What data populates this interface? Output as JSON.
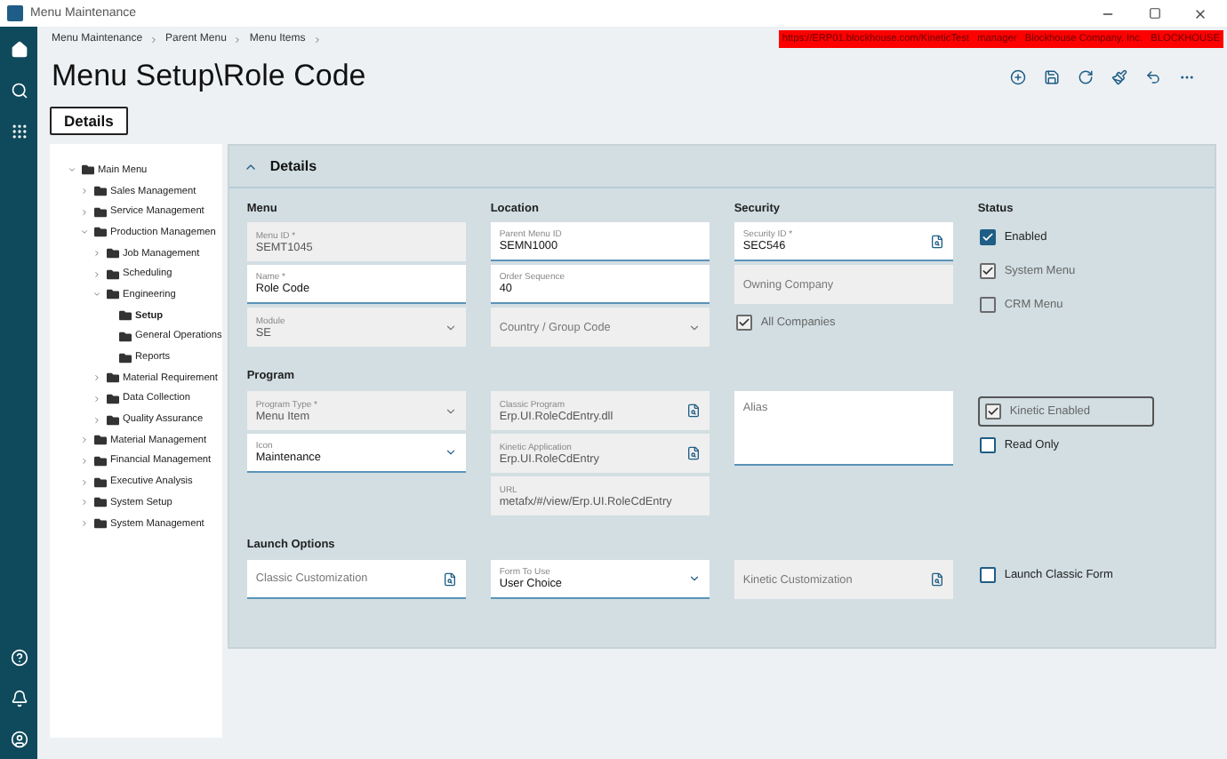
{
  "window": {
    "title": "Menu Maintenance"
  },
  "breadcrumbs": [
    "Menu Maintenance",
    "Parent Menu",
    "Menu Items"
  ],
  "connection_banner": "https://ERP01.blockhouse.com/KineticTest   manager   Blockhouse Company, Inc.   BLOCKHOUSE",
  "page_title": "Menu Setup\\Role Code",
  "tabs": [
    {
      "label": "Details",
      "selected": true
    }
  ],
  "tree": [
    {
      "label": "Main Menu",
      "expanded": true,
      "selected": false,
      "children": [
        {
          "label": "Sales Management",
          "expanded": false,
          "selected": false
        },
        {
          "label": "Service Management",
          "expanded": false,
          "selected": false
        },
        {
          "label": "Production Managemen",
          "expanded": true,
          "selected": false,
          "children": [
            {
              "label": "Job Management",
              "expanded": false,
              "selected": false
            },
            {
              "label": "Scheduling",
              "expanded": false,
              "selected": false
            },
            {
              "label": "Engineering",
              "expanded": true,
              "selected": false,
              "children": [
                {
                  "label": "Setup",
                  "selected": true
                },
                {
                  "label": "General Operations",
                  "selected": false
                },
                {
                  "label": "Reports",
                  "selected": false
                }
              ]
            },
            {
              "label": "Material Requirement",
              "expanded": false,
              "selected": false
            },
            {
              "label": "Data Collection",
              "expanded": false,
              "selected": false
            },
            {
              "label": "Quality Assurance",
              "expanded": false,
              "selected": false
            }
          ]
        },
        {
          "label": "Material Management",
          "expanded": false,
          "selected": false
        },
        {
          "label": "Financial Management",
          "expanded": false,
          "selected": false
        },
        {
          "label": "Executive Analysis",
          "expanded": false,
          "selected": false
        },
        {
          "label": "System Setup",
          "expanded": false,
          "selected": false
        },
        {
          "label": "System Management",
          "expanded": false,
          "selected": false
        }
      ]
    }
  ],
  "details": {
    "title": "Details",
    "expanded": true,
    "sections": [
      {
        "columns": [
          {
            "heading": "Menu",
            "items": [
              {
                "kind": "text",
                "label": "Menu ID *",
                "value": "SEMT1045",
                "editable": false
              },
              {
                "kind": "text",
                "label": "Name *",
                "value": "Role Code",
                "editable": true
              },
              {
                "kind": "dropdown",
                "label": "Module",
                "value": "SE",
                "editable": false
              }
            ]
          },
          {
            "heading": "Location",
            "items": [
              {
                "kind": "text",
                "label": "Parent Menu ID",
                "value": "SEMN1000",
                "editable": true
              },
              {
                "kind": "text",
                "label": "Order Sequence",
                "value": "40",
                "editable": true
              },
              {
                "kind": "dropdown",
                "placeholder": "Country / Group Code",
                "editable": false
              }
            ]
          },
          {
            "heading": "Security",
            "items": [
              {
                "kind": "lookup",
                "label": "Security ID *",
                "value": "SEC546",
                "editable": true
              },
              {
                "kind": "text",
                "placeholder": "Owning Company",
                "editable": false
              },
              {
                "kind": "checkbox",
                "label": "All Companies",
                "checked": true,
                "disabled": true
              }
            ]
          },
          {
            "heading": "Status",
            "items": [
              {
                "kind": "checkbox",
                "label": "Enabled",
                "checked": true,
                "disabled": false
              },
              {
                "kind": "checkbox",
                "label": "System Menu",
                "checked": true,
                "disabled": true
              },
              {
                "kind": "checkbox",
                "label": "CRM Menu",
                "checked": false,
                "disabled": true
              }
            ]
          }
        ]
      },
      {
        "heading": "Program",
        "columns": [
          {
            "items": [
              {
                "kind": "dropdown",
                "label": "Program Type *",
                "value": "Menu Item",
                "editable": false
              },
              {
                "kind": "dropdown",
                "label": "Icon",
                "value": "Maintenance",
                "editable": true
              }
            ]
          },
          {
            "items": [
              {
                "kind": "lookup",
                "label": "Classic Program",
                "value": "Erp.UI.RoleCdEntry.dll",
                "editable": false
              },
              {
                "kind": "lookup",
                "label": "Kinetic Application",
                "value": "Erp.UI.RoleCdEntry",
                "editable": false
              },
              {
                "kind": "text",
                "label": "URL",
                "value": "metafx/#/view/Erp.UI.RoleCdEntry",
                "editable": false
              }
            ]
          },
          {
            "items": [
              {
                "kind": "textarea",
                "placeholder": "Alias",
                "editable": true
              }
            ]
          },
          {
            "items": [
              {
                "kind": "checkbox",
                "label": "Kinetic Enabled",
                "checked": true,
                "disabled": true,
                "focused": true
              },
              {
                "kind": "checkbox",
                "label": "Read Only",
                "checked": false,
                "disabled": false
              }
            ]
          }
        ]
      },
      {
        "heading": "Launch Options",
        "columns": [
          {
            "items": [
              {
                "kind": "lookup",
                "placeholder": "Classic Customization",
                "editable": true
              }
            ]
          },
          {
            "items": [
              {
                "kind": "dropdown",
                "label": "Form To Use",
                "value": "User Choice",
                "editable": true
              }
            ]
          },
          {
            "items": [
              {
                "kind": "lookup",
                "placeholder": "Kinetic Customization",
                "editable": false
              }
            ]
          },
          {
            "items": [
              {
                "kind": "checkbox",
                "label": "Launch Classic Form",
                "checked": false,
                "disabled": false
              }
            ]
          }
        ]
      }
    ]
  }
}
